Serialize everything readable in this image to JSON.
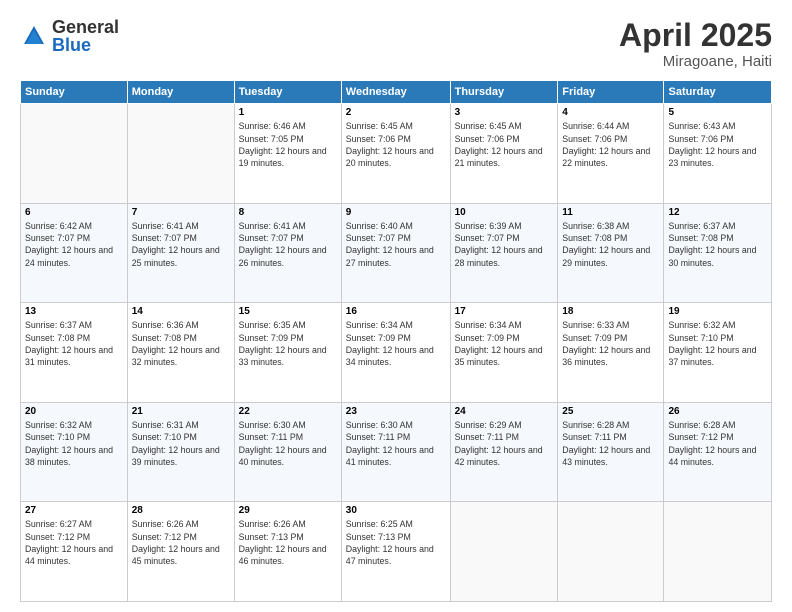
{
  "logo": {
    "general": "General",
    "blue": "Blue"
  },
  "title": {
    "month": "April 2025",
    "location": "Miragoane, Haiti"
  },
  "days_of_week": [
    "Sunday",
    "Monday",
    "Tuesday",
    "Wednesday",
    "Thursday",
    "Friday",
    "Saturday"
  ],
  "weeks": [
    [
      {
        "day": "",
        "detail": ""
      },
      {
        "day": "",
        "detail": ""
      },
      {
        "day": "1",
        "detail": "Sunrise: 6:46 AM\nSunset: 7:05 PM\nDaylight: 12 hours and 19 minutes."
      },
      {
        "day": "2",
        "detail": "Sunrise: 6:45 AM\nSunset: 7:06 PM\nDaylight: 12 hours and 20 minutes."
      },
      {
        "day": "3",
        "detail": "Sunrise: 6:45 AM\nSunset: 7:06 PM\nDaylight: 12 hours and 21 minutes."
      },
      {
        "day": "4",
        "detail": "Sunrise: 6:44 AM\nSunset: 7:06 PM\nDaylight: 12 hours and 22 minutes."
      },
      {
        "day": "5",
        "detail": "Sunrise: 6:43 AM\nSunset: 7:06 PM\nDaylight: 12 hours and 23 minutes."
      }
    ],
    [
      {
        "day": "6",
        "detail": "Sunrise: 6:42 AM\nSunset: 7:07 PM\nDaylight: 12 hours and 24 minutes."
      },
      {
        "day": "7",
        "detail": "Sunrise: 6:41 AM\nSunset: 7:07 PM\nDaylight: 12 hours and 25 minutes."
      },
      {
        "day": "8",
        "detail": "Sunrise: 6:41 AM\nSunset: 7:07 PM\nDaylight: 12 hours and 26 minutes."
      },
      {
        "day": "9",
        "detail": "Sunrise: 6:40 AM\nSunset: 7:07 PM\nDaylight: 12 hours and 27 minutes."
      },
      {
        "day": "10",
        "detail": "Sunrise: 6:39 AM\nSunset: 7:07 PM\nDaylight: 12 hours and 28 minutes."
      },
      {
        "day": "11",
        "detail": "Sunrise: 6:38 AM\nSunset: 7:08 PM\nDaylight: 12 hours and 29 minutes."
      },
      {
        "day": "12",
        "detail": "Sunrise: 6:37 AM\nSunset: 7:08 PM\nDaylight: 12 hours and 30 minutes."
      }
    ],
    [
      {
        "day": "13",
        "detail": "Sunrise: 6:37 AM\nSunset: 7:08 PM\nDaylight: 12 hours and 31 minutes."
      },
      {
        "day": "14",
        "detail": "Sunrise: 6:36 AM\nSunset: 7:08 PM\nDaylight: 12 hours and 32 minutes."
      },
      {
        "day": "15",
        "detail": "Sunrise: 6:35 AM\nSunset: 7:09 PM\nDaylight: 12 hours and 33 minutes."
      },
      {
        "day": "16",
        "detail": "Sunrise: 6:34 AM\nSunset: 7:09 PM\nDaylight: 12 hours and 34 minutes."
      },
      {
        "day": "17",
        "detail": "Sunrise: 6:34 AM\nSunset: 7:09 PM\nDaylight: 12 hours and 35 minutes."
      },
      {
        "day": "18",
        "detail": "Sunrise: 6:33 AM\nSunset: 7:09 PM\nDaylight: 12 hours and 36 minutes."
      },
      {
        "day": "19",
        "detail": "Sunrise: 6:32 AM\nSunset: 7:10 PM\nDaylight: 12 hours and 37 minutes."
      }
    ],
    [
      {
        "day": "20",
        "detail": "Sunrise: 6:32 AM\nSunset: 7:10 PM\nDaylight: 12 hours and 38 minutes."
      },
      {
        "day": "21",
        "detail": "Sunrise: 6:31 AM\nSunset: 7:10 PM\nDaylight: 12 hours and 39 minutes."
      },
      {
        "day": "22",
        "detail": "Sunrise: 6:30 AM\nSunset: 7:11 PM\nDaylight: 12 hours and 40 minutes."
      },
      {
        "day": "23",
        "detail": "Sunrise: 6:30 AM\nSunset: 7:11 PM\nDaylight: 12 hours and 41 minutes."
      },
      {
        "day": "24",
        "detail": "Sunrise: 6:29 AM\nSunset: 7:11 PM\nDaylight: 12 hours and 42 minutes."
      },
      {
        "day": "25",
        "detail": "Sunrise: 6:28 AM\nSunset: 7:11 PM\nDaylight: 12 hours and 43 minutes."
      },
      {
        "day": "26",
        "detail": "Sunrise: 6:28 AM\nSunset: 7:12 PM\nDaylight: 12 hours and 44 minutes."
      }
    ],
    [
      {
        "day": "27",
        "detail": "Sunrise: 6:27 AM\nSunset: 7:12 PM\nDaylight: 12 hours and 44 minutes."
      },
      {
        "day": "28",
        "detail": "Sunrise: 6:26 AM\nSunset: 7:12 PM\nDaylight: 12 hours and 45 minutes."
      },
      {
        "day": "29",
        "detail": "Sunrise: 6:26 AM\nSunset: 7:13 PM\nDaylight: 12 hours and 46 minutes."
      },
      {
        "day": "30",
        "detail": "Sunrise: 6:25 AM\nSunset: 7:13 PM\nDaylight: 12 hours and 47 minutes."
      },
      {
        "day": "",
        "detail": ""
      },
      {
        "day": "",
        "detail": ""
      },
      {
        "day": "",
        "detail": ""
      }
    ]
  ]
}
